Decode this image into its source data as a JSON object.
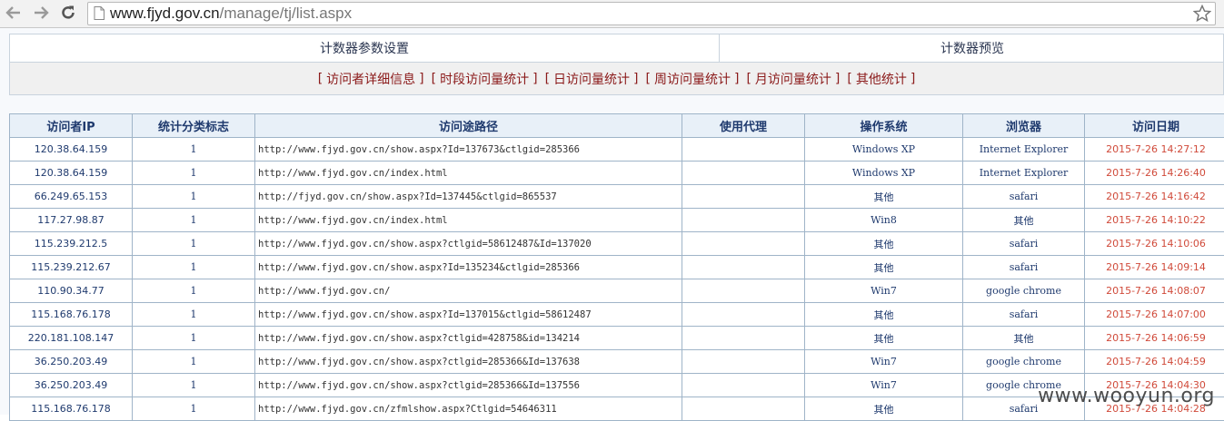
{
  "browser": {
    "url_host": "www.fjyd.gov.cn",
    "url_path": "/manage/tj/list.aspx"
  },
  "tabs": [
    "计数器参数设置",
    "计数器预览"
  ],
  "subnav": [
    "访问者详细信息",
    "时段访问量统计",
    "日访问量统计",
    "周访问量统计",
    "月访问量统计",
    "其他统计"
  ],
  "table": {
    "headers": [
      "访问者IP",
      "统计分类标志",
      "访问途路径",
      "使用代理",
      "操作系统",
      "浏览器",
      "访问日期"
    ],
    "rows": [
      {
        "ip": "120.38.64.159",
        "flag": "1",
        "path": "http://www.fjyd.gov.cn/show.aspx?Id=137673&ctlgid=285366",
        "proxy": "",
        "os": "Windows XP",
        "browser": "Internet Explorer",
        "date": "2015-7-26 14:27:12"
      },
      {
        "ip": "120.38.64.159",
        "flag": "1",
        "path": "http://www.fjyd.gov.cn/index.html",
        "proxy": "",
        "os": "Windows XP",
        "browser": "Internet Explorer",
        "date": "2015-7-26 14:26:40"
      },
      {
        "ip": "66.249.65.153",
        "flag": "1",
        "path": "http://fjyd.gov.cn/show.aspx?Id=137445&ctlgid=865537",
        "proxy": "",
        "os": "其他",
        "browser": "safari",
        "date": "2015-7-26 14:16:42"
      },
      {
        "ip": "117.27.98.87",
        "flag": "1",
        "path": "http://www.fjyd.gov.cn/index.html",
        "proxy": "",
        "os": "Win8",
        "browser": "其他",
        "date": "2015-7-26 14:10:22"
      },
      {
        "ip": "115.239.212.5",
        "flag": "1",
        "path": "http://www.fjyd.gov.cn/show.aspx?ctlgid=58612487&Id=137020",
        "proxy": "",
        "os": "其他",
        "browser": "safari",
        "date": "2015-7-26 14:10:06"
      },
      {
        "ip": "115.239.212.67",
        "flag": "1",
        "path": "http://www.fjyd.gov.cn/show.aspx?Id=135234&ctlgid=285366",
        "proxy": "",
        "os": "其他",
        "browser": "safari",
        "date": "2015-7-26 14:09:14"
      },
      {
        "ip": "110.90.34.77",
        "flag": "1",
        "path": "http://www.fjyd.gov.cn/",
        "proxy": "",
        "os": "Win7",
        "browser": "google chrome",
        "date": "2015-7-26 14:08:07"
      },
      {
        "ip": "115.168.76.178",
        "flag": "1",
        "path": "http://www.fjyd.gov.cn/show.aspx?Id=137015&ctlgid=58612487",
        "proxy": "",
        "os": "其他",
        "browser": "safari",
        "date": "2015-7-26 14:07:00"
      },
      {
        "ip": "220.181.108.147",
        "flag": "1",
        "path": "http://www.fjyd.gov.cn/show.aspx?ctlgid=428758&id=134214",
        "proxy": "",
        "os": "其他",
        "browser": "其他",
        "date": "2015-7-26 14:06:59"
      },
      {
        "ip": "36.250.203.49",
        "flag": "1",
        "path": "http://www.fjyd.gov.cn/show.aspx?ctlgid=285366&Id=137638",
        "proxy": "",
        "os": "Win7",
        "browser": "google chrome",
        "date": "2015-7-26 14:04:59"
      },
      {
        "ip": "36.250.203.49",
        "flag": "1",
        "path": "http://www.fjyd.gov.cn/show.aspx?ctlgid=285366&Id=137556",
        "proxy": "",
        "os": "Win7",
        "browser": "google chrome",
        "date": "2015-7-26 14:04:30"
      },
      {
        "ip": "115.168.76.178",
        "flag": "1",
        "path": "http://www.fjyd.gov.cn/zfmlshow.aspx?Ctlgid=54646311",
        "proxy": "",
        "os": "其他",
        "browser": "safari",
        "date": "2015-7-26 14:04:28"
      }
    ]
  },
  "watermark": "www.wooyun.org"
}
